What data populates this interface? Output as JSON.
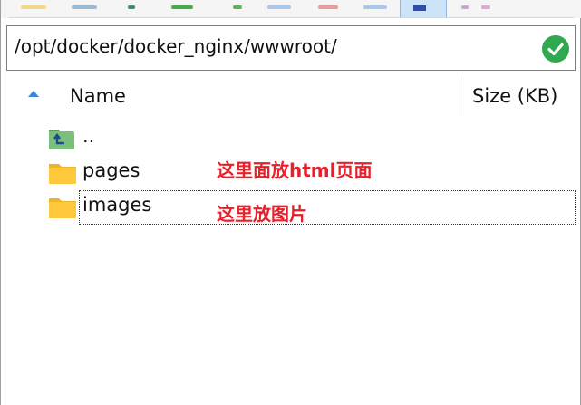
{
  "path_bar": {
    "path": "/opt/docker/docker_nginx/wwwroot/",
    "confirm_icon": "checkmark-circle-icon"
  },
  "file_list": {
    "columns": {
      "name": "Name",
      "size": "Size (KB)"
    },
    "sort_icon": "sort-ascending-icon",
    "rows": [
      {
        "name": "..",
        "icon": "parent-folder-icon"
      },
      {
        "name": "pages",
        "icon": "folder-icon"
      },
      {
        "name": "images",
        "icon": "folder-icon"
      }
    ]
  },
  "annotations": {
    "pages_note": "这里面放html页面",
    "images_note": "这里放图片"
  },
  "colors": {
    "folder": "#ffc83d",
    "annotation": "#e8202a",
    "confirm": "#2fa84f",
    "sort_arrow": "#3a86d8"
  }
}
